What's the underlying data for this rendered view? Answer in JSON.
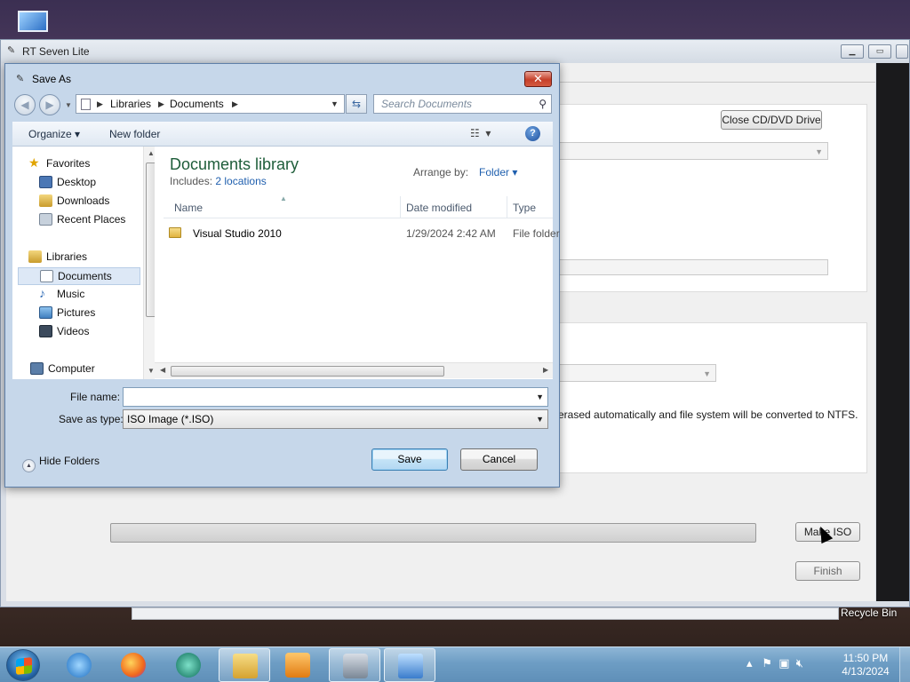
{
  "app": {
    "title": "RT Seven Lite",
    "close_drive_label": "Close CD/DVD Drive",
    "info_text_fragment": "erased automatically and file system will be converted to NTFS.",
    "make_iso_label": "Make ISO",
    "finish_label": "Finish"
  },
  "dialog": {
    "title": "Save As",
    "breadcrumb": [
      "Libraries",
      "Documents"
    ],
    "search_placeholder": "Search Documents",
    "organize_label": "Organize",
    "new_folder_label": "New folder",
    "nav": {
      "favorites": "Favorites",
      "desktop": "Desktop",
      "downloads": "Downloads",
      "recent_places": "Recent Places",
      "libraries": "Libraries",
      "documents": "Documents",
      "music": "Music",
      "pictures": "Pictures",
      "videos": "Videos",
      "computer": "Computer"
    },
    "library_title": "Documents library",
    "includes_label": "Includes:",
    "includes_link": "2 locations",
    "arrange_by_label": "Arrange by:",
    "arrange_by_value": "Folder",
    "columns": {
      "name": "Name",
      "date_modified": "Date modified",
      "type": "Type"
    },
    "files": [
      {
        "name": "Visual Studio 2010",
        "date_modified": "1/29/2024 2:42 AM",
        "type": "File folder"
      }
    ],
    "file_name_label": "File name:",
    "file_name_value": "",
    "save_as_type_label": "Save as type:",
    "save_as_type_value": "ISO Image (*.ISO)",
    "hide_folders_label": "Hide Folders",
    "save_label": "Save",
    "cancel_label": "Cancel"
  },
  "desktop": {
    "recycle_bin_label": "Recycle Bin"
  },
  "taskbar": {
    "time": "11:50 PM",
    "date": "4/13/2024",
    "pinned_icons": [
      "internet-explorer-icon",
      "firefox-icon",
      "media-app-icon",
      "file-explorer-icon",
      "media-player-icon",
      "rt-seven-lite-icon",
      "control-panel-icon"
    ]
  },
  "colors": {
    "library_title": "#1e5d3a",
    "link": "#1f5fae",
    "taskbar": "#6d9dc4"
  }
}
